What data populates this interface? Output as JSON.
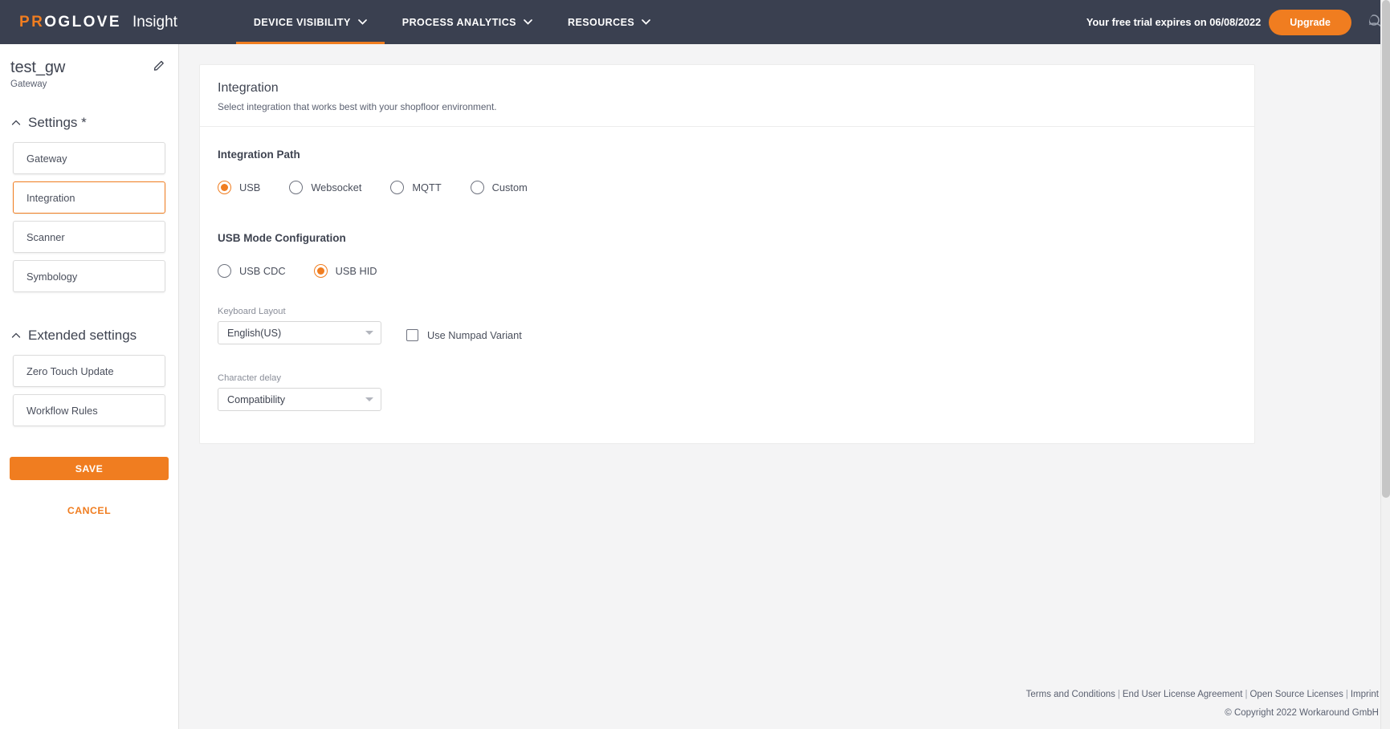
{
  "topbar": {
    "brand_pro": "PROGLOVE",
    "brand_product": "Insight",
    "nav": [
      {
        "label": "DEVICE VISIBILITY",
        "icon": "chevron-down-icon",
        "active": true
      },
      {
        "label": "PROCESS ANALYTICS",
        "icon": "chevron-down-icon",
        "active": false
      },
      {
        "label": "RESOURCES",
        "icon": "chevron-down-icon",
        "active": false
      }
    ],
    "trial_text": "Your free trial expires on 06/08/2022",
    "upgrade_label": "Upgrade",
    "accent_color": "#f07d20",
    "bar_color": "#3a4050"
  },
  "sidebar": {
    "device_name": "test_gw",
    "device_type": "Gateway",
    "edit_icon": "pencil-icon",
    "sections": [
      {
        "title": "Settings *",
        "chevron": "chevron-up-icon",
        "items": [
          {
            "label": "Gateway",
            "selected": false
          },
          {
            "label": "Integration",
            "selected": true
          },
          {
            "label": "Scanner",
            "selected": false
          },
          {
            "label": "Symbology",
            "selected": false
          }
        ]
      },
      {
        "title": "Extended settings",
        "chevron": "chevron-up-icon",
        "items": [
          {
            "label": "Zero Touch Update",
            "selected": false
          },
          {
            "label": "Workflow Rules",
            "selected": false
          }
        ]
      }
    ],
    "save_label": "SAVE",
    "cancel_label": "CANCEL"
  },
  "main": {
    "card_title": "Integration",
    "card_subtitle": "Select integration that works best with your shopfloor environment.",
    "integration_path": {
      "title": "Integration Path",
      "options": [
        {
          "label": "USB",
          "checked": true
        },
        {
          "label": "Websocket",
          "checked": false
        },
        {
          "label": "MQTT",
          "checked": false
        },
        {
          "label": "Custom",
          "checked": false
        }
      ]
    },
    "usb_mode": {
      "title": "USB Mode Configuration",
      "options": [
        {
          "label": "USB CDC",
          "checked": false
        },
        {
          "label": "USB HID",
          "checked": true
        }
      ]
    },
    "keyboard_layout": {
      "label": "Keyboard Layout",
      "value": "English(US)",
      "arrow_icon": "chevron-down-icon"
    },
    "numpad": {
      "label": "Use Numpad Variant",
      "checked": false
    },
    "character_delay": {
      "label": "Character delay",
      "value": "Compatibility",
      "arrow_icon": "chevron-down-icon"
    }
  },
  "footer": {
    "links": [
      "Terms and Conditions",
      "End User License Agreement",
      "Open Source Licenses",
      "Imprint"
    ],
    "separator": "|",
    "copyright": "© Copyright 2022 Workaround GmbH"
  }
}
